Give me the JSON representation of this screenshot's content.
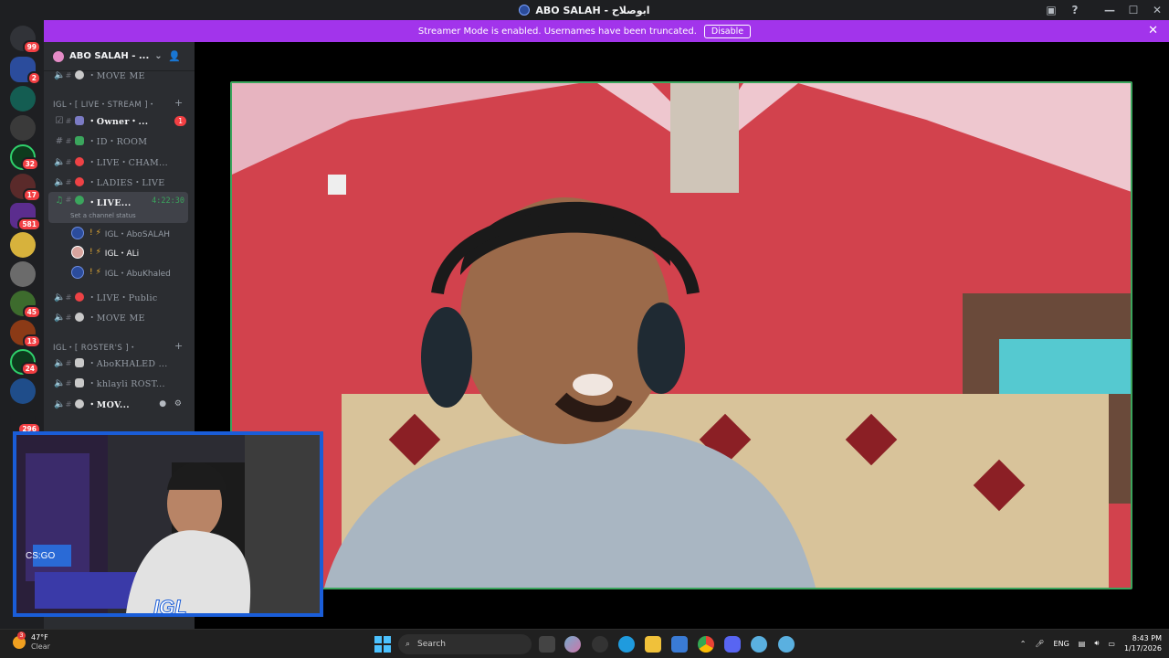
{
  "window": {
    "title": "ABO SALAH - ابوصلاح",
    "controls": [
      "inbox-icon",
      "help-icon",
      "minimize-icon",
      "maximize-icon",
      "close-icon"
    ]
  },
  "banner": {
    "text": "Streamer Mode is enabled. Usernames have been truncated.",
    "button": "Disable",
    "color": "#a234eb"
  },
  "guilds": [
    {
      "badge": "99"
    },
    {
      "badge": "2"
    },
    {
      "badge": ""
    },
    {
      "badge": ""
    },
    {
      "badge": "32"
    },
    {
      "badge": "17"
    },
    {
      "badge": "581"
    },
    {
      "badge": ""
    },
    {
      "badge": ""
    },
    {
      "badge": "45"
    },
    {
      "badge": "13"
    },
    {
      "badge": "24"
    },
    {
      "badge": ""
    },
    {
      "badge": "296"
    }
  ],
  "server": {
    "name": "ABO SALAH - ...",
    "categories": [
      {
        "name": "IGL・[ LIVE・STREAM ]・"
      },
      {
        "name": "IGL・[ ROSTER'S ]・"
      }
    ],
    "channels": [
      {
        "label": "・MOVE ME"
      },
      {
        "label": "・Owner・..."
      },
      {
        "label": "・ID・ROOM"
      },
      {
        "label": "・LIVE・CHAM..."
      },
      {
        "label": "・LADIES・LIVE"
      },
      {
        "label": "・LIVE...",
        "timer": "4:22:30",
        "status": "Set a channel status"
      },
      {
        "label": "・LIVE・Public"
      },
      {
        "label": "・MOVE ME"
      },
      {
        "label": "・AboKHALED ..."
      },
      {
        "label": "・khlayli ROST..."
      },
      {
        "label": "・MOV..."
      }
    ],
    "unread_badge": "1",
    "voice_users": [
      {
        "name": "IGL・AboSALAH"
      },
      {
        "name": "IGL・ALi"
      },
      {
        "name": "IGL・AbuKhaled"
      }
    ]
  },
  "overlay": {
    "brand": "IGL"
  },
  "taskbar": {
    "weather_temp": "47°F",
    "weather_text": "Clear",
    "weather_badge": "3",
    "search_placeholder": "Search",
    "lang": "ENG",
    "time": "8:43 PM",
    "date": "1/17/2026"
  }
}
